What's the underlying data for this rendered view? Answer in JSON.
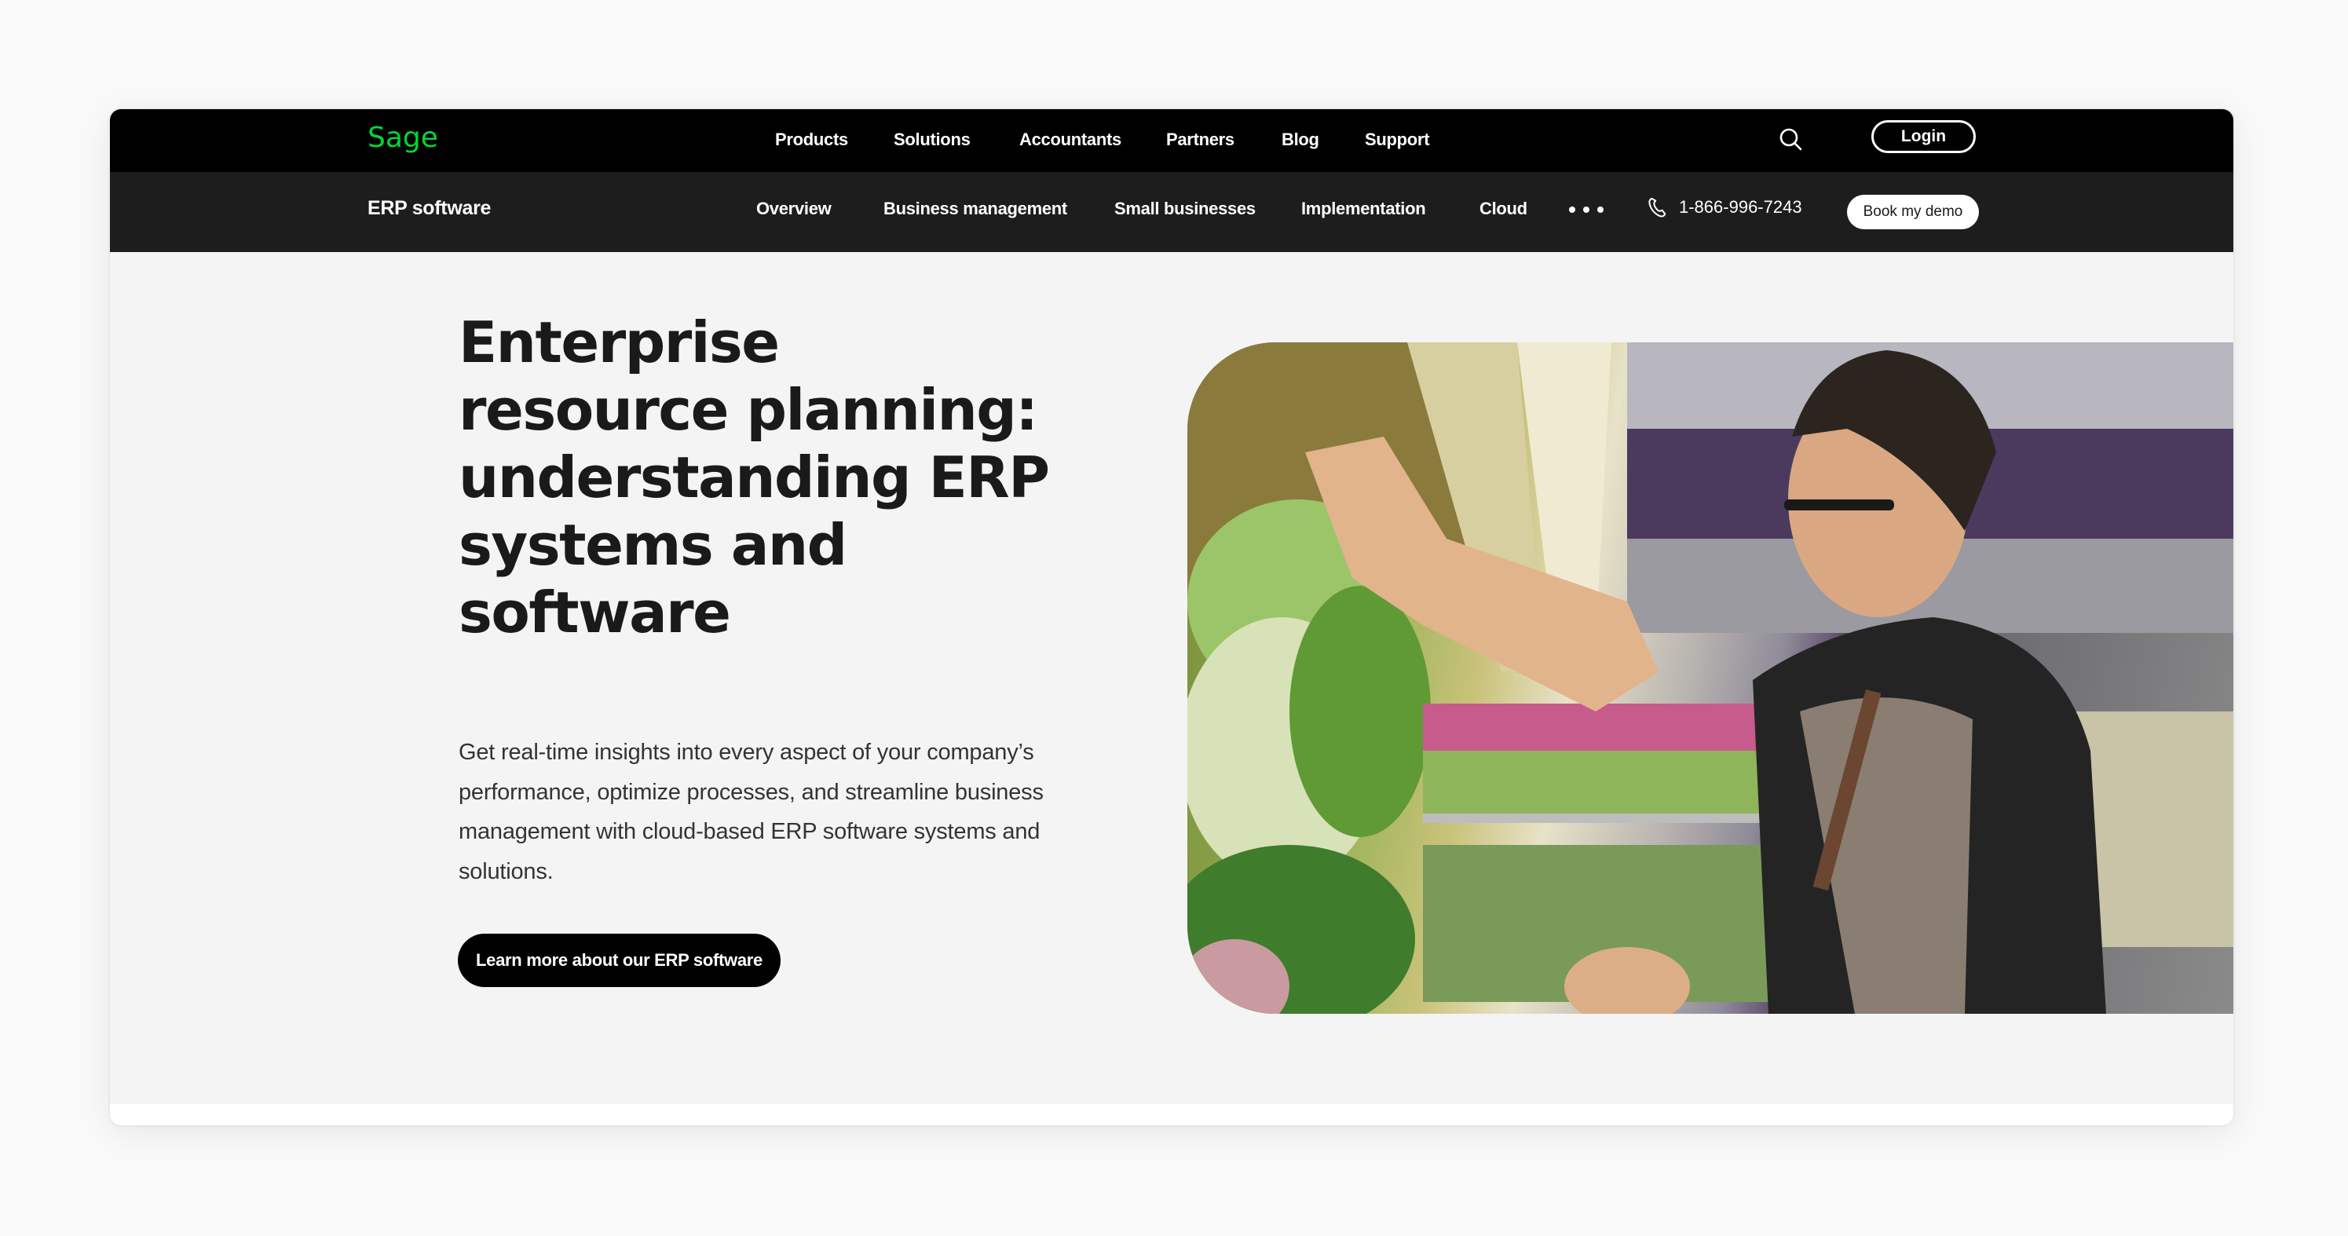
{
  "brand": {
    "logo_text": "Sage",
    "logo_color": "#00D639"
  },
  "top_nav": {
    "items": [
      {
        "label": "Products"
      },
      {
        "label": "Solutions"
      },
      {
        "label": "Accountants"
      },
      {
        "label": "Partners"
      },
      {
        "label": "Blog"
      },
      {
        "label": "Support"
      }
    ],
    "search_icon": "search-icon",
    "login_label": "Login"
  },
  "sub_nav": {
    "section_label": "ERP software",
    "items": [
      {
        "label": "Overview"
      },
      {
        "label": "Business management"
      },
      {
        "label": "Small businesses"
      },
      {
        "label": "Implementation"
      },
      {
        "label": "Cloud"
      }
    ],
    "more_icon": "more-horizontal-icon",
    "phone_icon": "phone-icon",
    "phone_number": "1-866-996-7243",
    "demo_label": "Book my demo"
  },
  "hero": {
    "title": "Enterprise resource planning: understanding ERP systems and software",
    "description": "Get real-time insights into every aspect of your company’s performance, optimize processes, and streamline business management with cloud-based ERP software systems and solutions.",
    "cta_label": "Learn more about our ERP software",
    "image_alt": "Grocery worker in apron stocking leafy greens on a produce shelf"
  },
  "colors": {
    "page_background": "#F9F9F9",
    "top_nav_background": "#000000",
    "sub_nav_background": "#1D1D1D",
    "hero_background": "#F4F4F4",
    "heading_text": "#1A1A1A",
    "body_text": "#333333"
  }
}
